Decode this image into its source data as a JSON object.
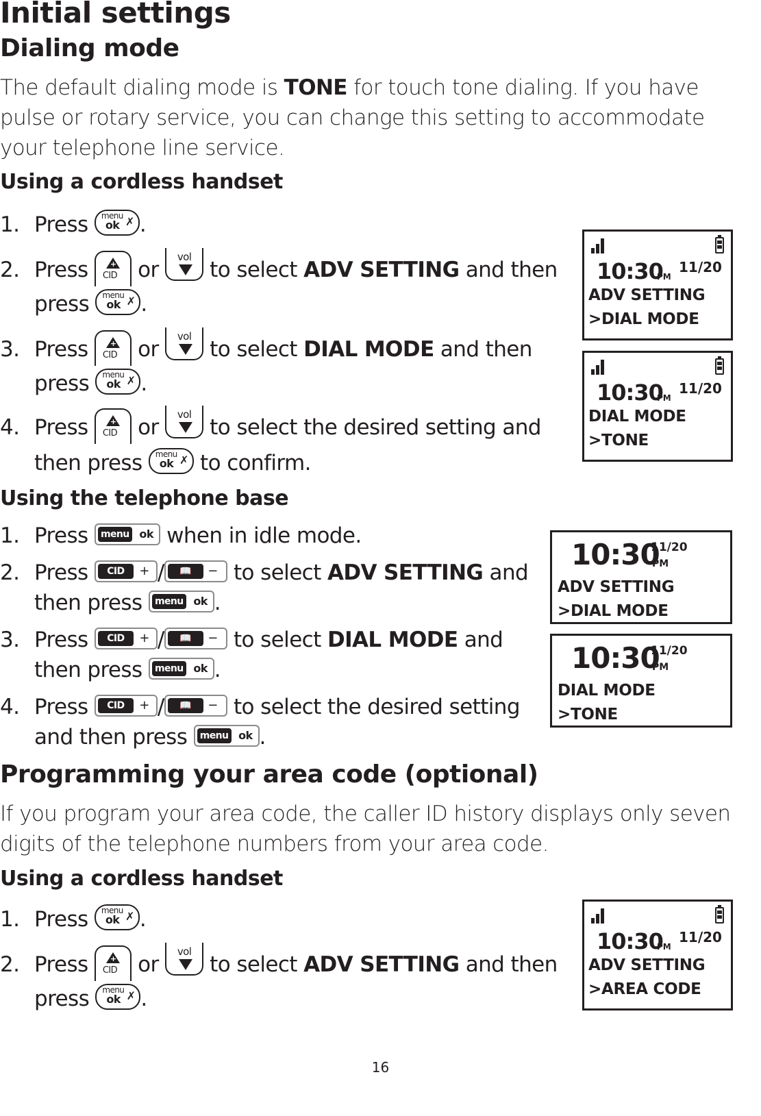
{
  "page": {
    "title": "Initial settings",
    "page_number": "16"
  },
  "dialing_mode": {
    "heading": "Dialing mode",
    "intro": {
      "before": "The default dialing mode is ",
      "bold": "TONE",
      "after_line1": " for touch tone dialing. If you have",
      "line2": "pulse or rotary service, you can change this setting to accommodate",
      "line3": "your telephone line service."
    },
    "handset": {
      "heading": "Using a cordless handset",
      "steps": [
        {
          "num": "1.",
          "press": "Press",
          "end": "."
        },
        {
          "num": "2.",
          "press": "Press",
          "or": "or",
          "mid": "to select",
          "bold": "ADV SETTING",
          "tail": "and then",
          "cont": "press",
          "end": "."
        },
        {
          "num": "3.",
          "press": "Press",
          "or": "or",
          "mid": "to select",
          "bold": "DIAL MODE",
          "tail": "and then",
          "cont": "press",
          "end": "."
        },
        {
          "num": "4.",
          "press": "Press",
          "or": "or",
          "mid": "to select the desired setting and",
          "cont": "then press",
          "end": "to confirm."
        }
      ],
      "screens": [
        {
          "time": "10:30",
          "ampm": "PM",
          "date": "11/20",
          "line1": "ADV SETTING",
          "line2": ">DIAL MODE"
        },
        {
          "time": "10:30",
          "ampm": "PM",
          "date": "11/20",
          "line1": "DIAL MODE",
          "line2": ">TONE"
        }
      ]
    },
    "base": {
      "heading": "Using the telephone base",
      "steps": [
        {
          "num": "1.",
          "press": "Press",
          "end": "when in idle mode."
        },
        {
          "num": "2.",
          "press": "Press",
          "slash": "/",
          "mid": "to select",
          "bold": "ADV SETTING",
          "tail": "and",
          "cont": "then press",
          "end": "."
        },
        {
          "num": "3.",
          "press": "Press",
          "slash": "/",
          "mid": "to select",
          "bold": "DIAL MODE",
          "tail": "and",
          "cont": "then press",
          "end": "."
        },
        {
          "num": "4.",
          "press": "Press",
          "slash": "/",
          "mid": "to select the desired setting",
          "cont": "and then press",
          "end": "."
        }
      ],
      "screens": [
        {
          "time": "10:30",
          "ampm": "PM",
          "date": "11/20",
          "line1": "ADV SETTING",
          "line2": ">DIAL MODE"
        },
        {
          "time": "10:30",
          "ampm": "PM",
          "date": "11/20",
          "line1": "DIAL MODE",
          "line2": ">TONE"
        }
      ]
    }
  },
  "area_code": {
    "heading": "Programming your area code (optional)",
    "intro_line1": "If you program your area code, the caller ID history displays only seven",
    "intro_line2": "digits of the telephone numbers from your area code.",
    "handset": {
      "heading": "Using a cordless handset",
      "steps": [
        {
          "num": "1.",
          "press": "Press",
          "end": "."
        },
        {
          "num": "2.",
          "press": "Press",
          "or": "or",
          "mid": "to select",
          "bold": "ADV SETTING",
          "tail": "and then",
          "cont": "press",
          "end": "."
        }
      ],
      "screens": [
        {
          "time": "10:30",
          "ampm": "PM",
          "date": "11/20",
          "line1": "ADV SETTING",
          "line2": ">AREA CODE"
        }
      ]
    }
  },
  "keys": {
    "handset_menu": {
      "top": "menu",
      "bottom": "ok",
      "icon": "mute-icon"
    },
    "handset_cid": {
      "label": "CID",
      "icon": "up-plus-arrow-icon"
    },
    "handset_vol": {
      "label": "vol",
      "icon": "down-minus-arrow-icon"
    },
    "base_menu": {
      "dark": "menu",
      "light": "ok"
    },
    "base_cid": {
      "dark": "CID",
      "light": "+"
    },
    "base_book": {
      "dark": "📖",
      "light": "−"
    }
  }
}
